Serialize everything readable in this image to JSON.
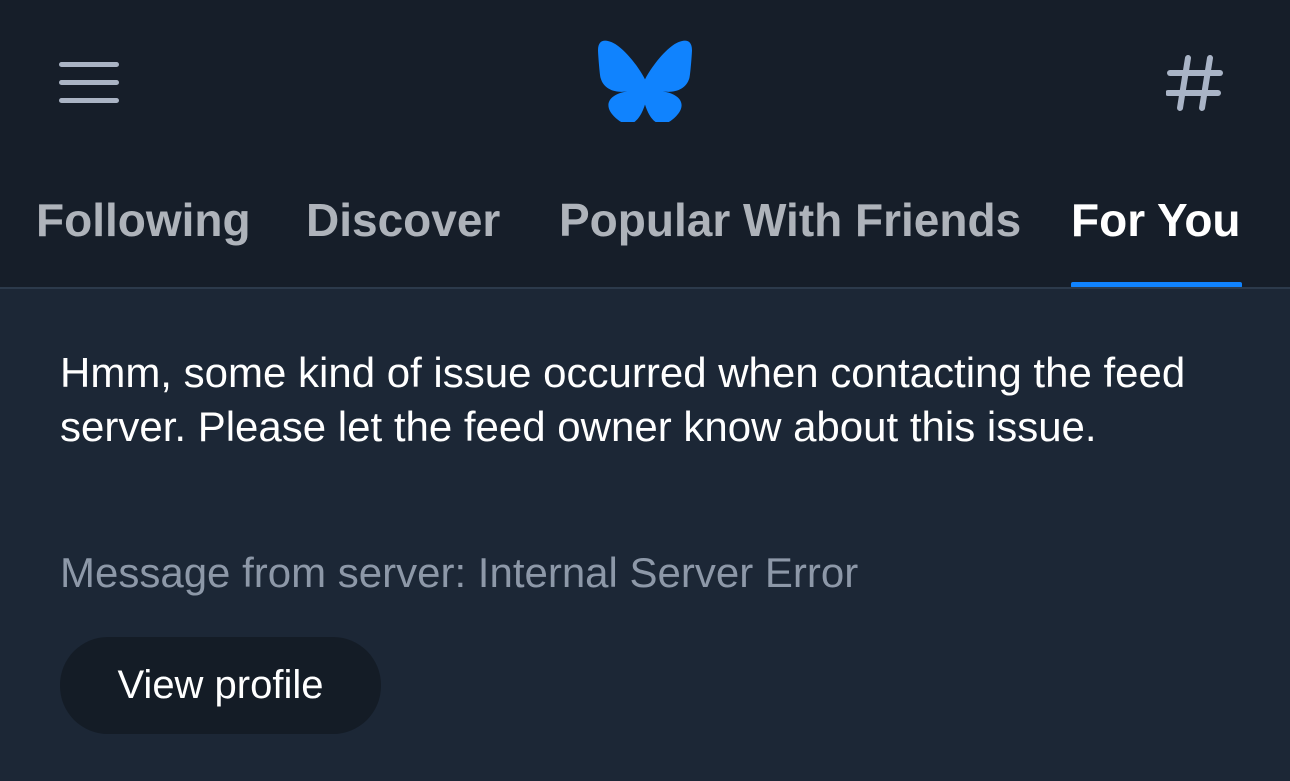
{
  "header": {
    "menu_icon": "hamburger-menu-icon",
    "logo_icon": "butterfly-logo-icon",
    "feeds_icon": "hashtag-icon",
    "logo_color": "#1083fe"
  },
  "tabs": [
    {
      "label": "Following",
      "active": false
    },
    {
      "label": "Discover",
      "active": false
    },
    {
      "label": "Popular With Friends",
      "active": false
    },
    {
      "label": "For You",
      "active": true
    }
  ],
  "error": {
    "message": "Hmm, some kind of issue occurred when contacting the feed server. Please let the feed owner know about this issue.",
    "server_message": "Message from server: Internal Server Error",
    "button_label": "View profile"
  },
  "colors": {
    "accent": "#1083fe",
    "header_bg": "#161e29",
    "content_bg": "#1c2736"
  }
}
